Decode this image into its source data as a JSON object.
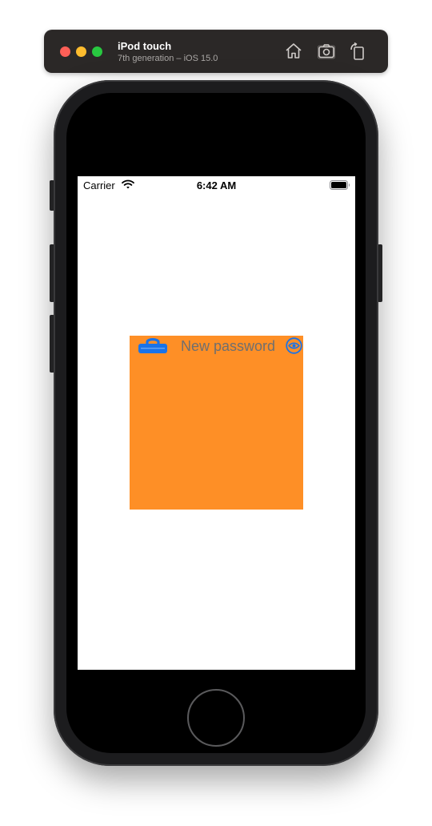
{
  "simulator": {
    "device_name": "iPod touch",
    "device_subtitle": "7th generation – iOS 15.0",
    "buttons": [
      "home-icon",
      "screenshot-icon",
      "rotate-icon"
    ]
  },
  "status_bar": {
    "carrier": "Carrier",
    "time": "6:42 AM"
  },
  "content": {
    "password_placeholder": "New password",
    "box_color": "#fe8f26",
    "icon_color": "#1a73e8"
  }
}
